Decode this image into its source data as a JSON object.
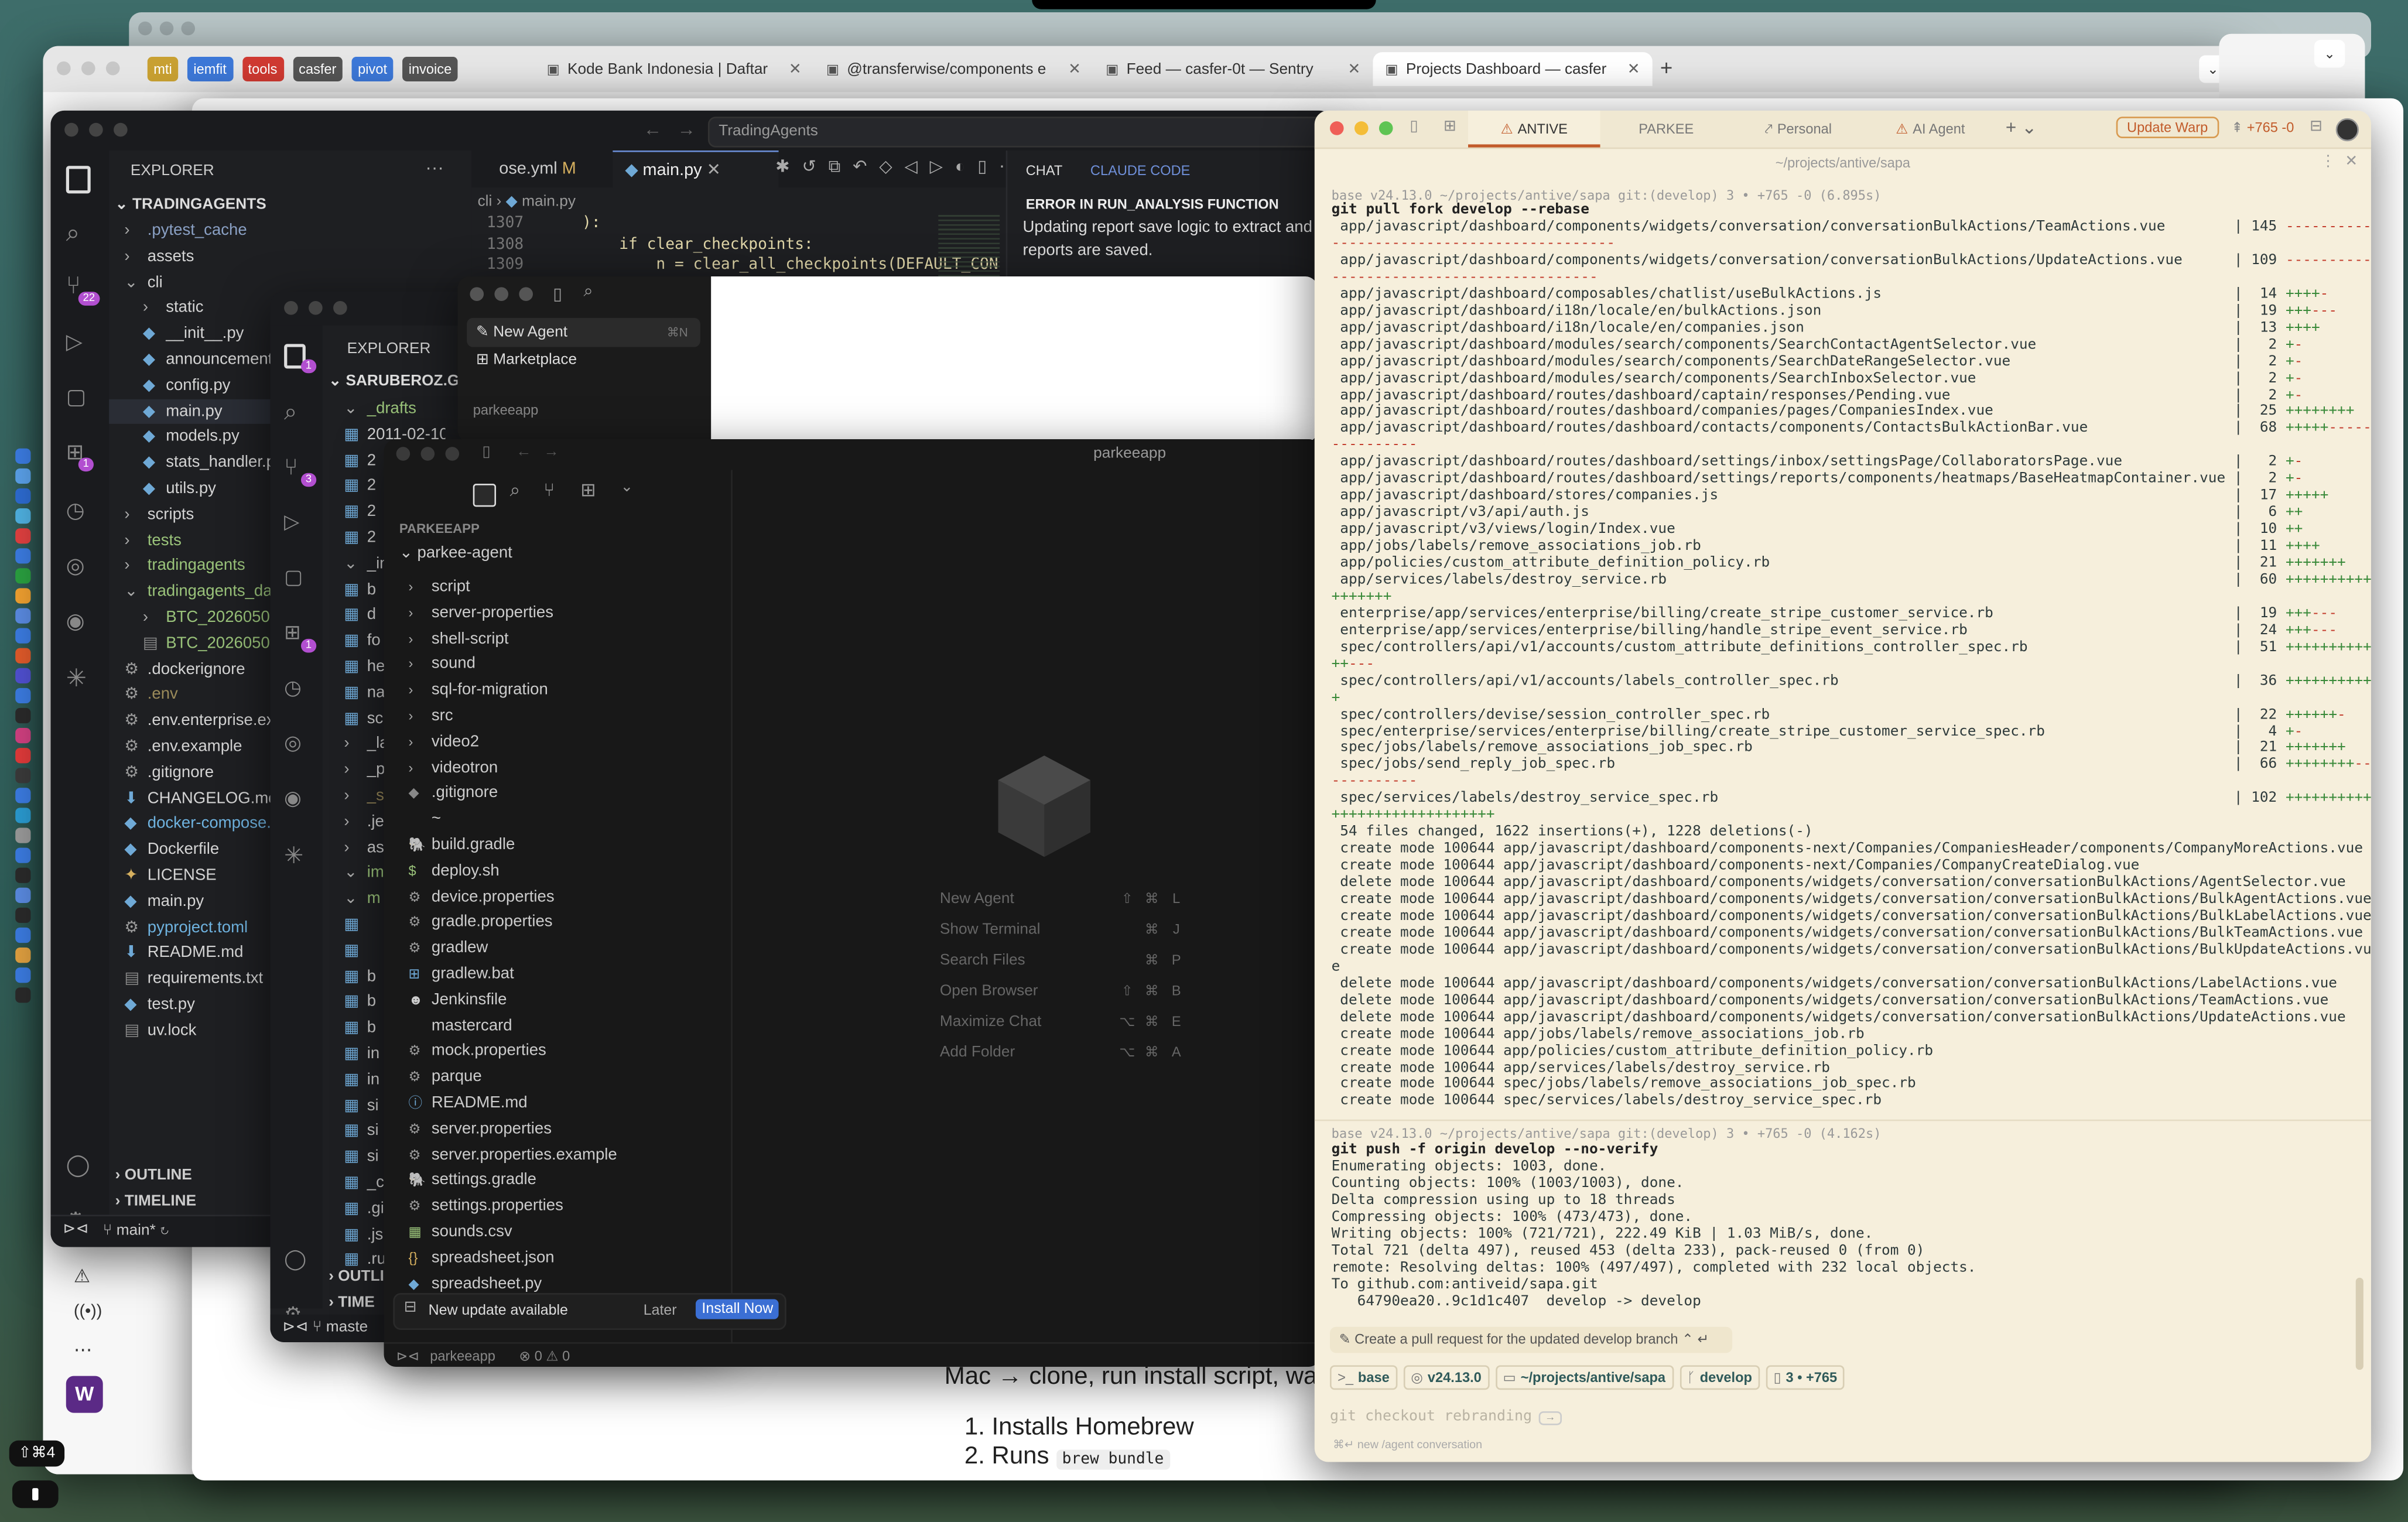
{
  "browser": {
    "tabs_pinned": [
      "mti",
      "iemfit",
      "tools",
      "casfer",
      "pivot",
      "invoice"
    ],
    "tabs": [
      {
        "label": "Kode Bank Indonesia | Daftar",
        "icon": "bank-tab-icon"
      },
      {
        "label": "@transferwise/components e",
        "icon": "npm-tab-icon"
      },
      {
        "label": "Feed — casfer-0t — Sentry",
        "icon": "sentry-tab-icon"
      },
      {
        "label": "Projects Dashboard — casfer",
        "icon": "sentry-tab-icon"
      }
    ],
    "new_tab": "+"
  },
  "vscode": {
    "title": "TradingAgents",
    "explorer": "EXPLORER",
    "project": "TRADINGAGENTS",
    "scm_badge": "22",
    "ext_badge": "1",
    "tree": [
      {
        "label": ".pytest_cache",
        "indent": 0,
        "type": "folder",
        "color": "#8aa0c4"
      },
      {
        "label": "assets",
        "indent": 0,
        "type": "folder",
        "color": "#d4d4d4"
      },
      {
        "label": "cli",
        "indent": 0,
        "type": "open",
        "color": "#d4d4d4"
      },
      {
        "label": "static",
        "indent": 1,
        "type": "folder",
        "color": "#d4d4d4"
      },
      {
        "label": "__init__.py",
        "indent": 1,
        "type": "py",
        "color": "#d4d4d4"
      },
      {
        "label": "announcements.",
        "indent": 1,
        "type": "py",
        "color": "#d4d4d4"
      },
      {
        "label": "config.py",
        "indent": 1,
        "type": "py",
        "color": "#d4d4d4"
      },
      {
        "label": "main.py",
        "indent": 1,
        "type": "py",
        "color": "#d4d4d4",
        "active": true
      },
      {
        "label": "models.py",
        "indent": 1,
        "type": "py",
        "color": "#d4d4d4"
      },
      {
        "label": "stats_handler.py",
        "indent": 1,
        "type": "py",
        "color": "#d4d4d4"
      },
      {
        "label": "utils.py",
        "indent": 1,
        "type": "py",
        "color": "#d4d4d4"
      },
      {
        "label": "scripts",
        "indent": 0,
        "type": "folder",
        "color": "#d4d4d4"
      },
      {
        "label": "tests",
        "indent": 0,
        "type": "folder",
        "color": "#9ac37a"
      },
      {
        "label": "tradingagents",
        "indent": 0,
        "type": "folder",
        "color": "#9ac37a"
      },
      {
        "label": "tradingagents_da",
        "indent": 0,
        "type": "open",
        "color": "#9ac37a"
      },
      {
        "label": "BTC_20260508_",
        "indent": 1,
        "type": "folder",
        "color": "#9ac37a"
      },
      {
        "label": "BTC_20260508_",
        "indent": 1,
        "type": "file",
        "color": "#9ac37a"
      },
      {
        "label": ".dockerignore",
        "indent": 0,
        "type": "gear",
        "color": "#d4d4d4"
      },
      {
        "label": ".env",
        "indent": 0,
        "type": "gear",
        "color": "#9a8a5a"
      },
      {
        "label": ".env.enterprise.ex",
        "indent": 0,
        "type": "gear",
        "color": "#d4d4d4"
      },
      {
        "label": ".env.example",
        "indent": 0,
        "type": "gear",
        "color": "#d4d4d4"
      },
      {
        "label": ".gitignore",
        "indent": 0,
        "type": "gear",
        "color": "#d4d4d4"
      },
      {
        "label": "CHANGELOG.md",
        "indent": 0,
        "type": "md",
        "color": "#d4d4d4"
      },
      {
        "label": "docker-compose.y",
        "indent": 0,
        "type": "py",
        "color": "#6fb3e0"
      },
      {
        "label": "Dockerfile",
        "indent": 0,
        "type": "py",
        "color": "#d4d4d4"
      },
      {
        "label": "LICENSE",
        "indent": 0,
        "type": "lic",
        "color": "#d4d4d4"
      },
      {
        "label": "main.py",
        "indent": 0,
        "type": "py",
        "color": "#d4d4d4"
      },
      {
        "label": "pyproject.toml",
        "indent": 0,
        "type": "gear",
        "color": "#6fb3e0"
      },
      {
        "label": "README.md",
        "indent": 0,
        "type": "md",
        "color": "#d4d4d4"
      },
      {
        "label": "requirements.txt",
        "indent": 0,
        "type": "file",
        "color": "#d4d4d4"
      },
      {
        "label": "test.py",
        "indent": 0,
        "type": "py",
        "color": "#d4d4d4"
      },
      {
        "label": "uv.lock",
        "indent": 0,
        "type": "file",
        "color": "#d4d4d4"
      }
    ],
    "outline": "OUTLINE",
    "timeline": "TIMELINE",
    "branch": "main*",
    "tab1": "ose.yml",
    "tab1_mark": "M",
    "tab2": "main.py",
    "breadcrumb_a": "cli",
    "breadcrumb_b": "main.py",
    "code": [
      {
        "ln": "1307",
        "text": "    ):"
      },
      {
        "ln": "1308",
        "text": "        if clear_checkpoints:"
      },
      {
        "ln": "1309",
        "text": "            n = clear_all_checkpoints(DEFAULT_CON"
      }
    ],
    "chat_tab": "CHAT",
    "claude_tab": "CLAUDE CODE",
    "chat_heading": "ERROR IN RUN_ANALYSIS FUNCTION",
    "chat_text_1": "Updating report save logic to extract and",
    "chat_text_2": "reports are saved."
  },
  "editor2": {
    "explorer": "EXPLORER",
    "project": "SARUBEROZ.GIT",
    "badge_a": "1",
    "badge_b": "3",
    "badge_c": "1",
    "tree": [
      {
        "label": "_drafts",
        "color": "#9ac37a",
        "type": "open"
      },
      {
        "label": "2011-02-10",
        "color": "#d4d4d4",
        "type": "file"
      },
      {
        "label": "2",
        "color": "#d4d4d4",
        "type": "file"
      },
      {
        "label": "2",
        "color": "#d4d4d4",
        "type": "file"
      },
      {
        "label": "2",
        "color": "#d4d4d4",
        "type": "file"
      },
      {
        "label": "2",
        "color": "#d4d4d4",
        "type": "file"
      },
      {
        "label": "_in",
        "color": "#d4d4d4",
        "type": "open"
      },
      {
        "label": "b",
        "color": "#d4d4d4",
        "type": "file"
      },
      {
        "label": "d",
        "color": "#d4d4d4",
        "type": "file"
      },
      {
        "label": "fo",
        "color": "#d4d4d4",
        "type": "file"
      },
      {
        "label": "he",
        "color": "#d4d4d4",
        "type": "file"
      },
      {
        "label": "na",
        "color": "#d4d4d4",
        "type": "file"
      },
      {
        "label": "sc",
        "color": "#d4d4d4",
        "type": "file"
      },
      {
        "label": "_la",
        "color": "#d4d4d4",
        "type": "folder"
      },
      {
        "label": "_p",
        "color": "#d4d4d4",
        "type": "folder"
      },
      {
        "label": "_si",
        "color": "#9a8a5a",
        "type": "folder"
      },
      {
        "label": ".jel",
        "color": "#d4d4d4",
        "type": "folder"
      },
      {
        "label": "ass",
        "color": "#d4d4d4",
        "type": "folder"
      },
      {
        "label": "ima",
        "color": "#9ac37a",
        "type": "open"
      },
      {
        "label": "m",
        "color": "#9ac37a",
        "type": "open"
      },
      {
        "label": "",
        "color": "#d4d4d4",
        "type": "file"
      },
      {
        "label": "",
        "color": "#d4d4d4",
        "type": "file"
      },
      {
        "label": "b",
        "color": "#d4d4d4",
        "type": "file"
      },
      {
        "label": "b",
        "color": "#d4d4d4",
        "type": "file"
      },
      {
        "label": "b",
        "color": "#d4d4d4",
        "type": "file"
      },
      {
        "label": "in",
        "color": "#d4d4d4",
        "type": "file"
      },
      {
        "label": "in",
        "color": "#d4d4d4",
        "type": "file"
      },
      {
        "label": "si",
        "color": "#d4d4d4",
        "type": "file"
      },
      {
        "label": "si",
        "color": "#d4d4d4",
        "type": "file"
      },
      {
        "label": "si",
        "color": "#d4d4d4",
        "type": "file"
      },
      {
        "label": "_co",
        "color": "#d4d4d4",
        "type": "file"
      },
      {
        "label": ".git",
        "color": "#d4d4d4",
        "type": "file"
      },
      {
        "label": ".jsh",
        "color": "#d4d4d4",
        "type": "file"
      },
      {
        "label": ".ru",
        "color": "#d4d4d4",
        "type": "file"
      }
    ],
    "outline": "OUTLI",
    "timeline": "TIME",
    "branch": "maste"
  },
  "cursor": {
    "menu_new_agent": "New Agent",
    "menu_new_agent_kbd": "⌘N",
    "menu_marketplace": "Marketplace",
    "section": "parkeeapp",
    "title": "parkeeapp",
    "project": "PARKEEAPP",
    "folder": "parkee-agent",
    "tree": [
      {
        "label": "script",
        "type": "folder"
      },
      {
        "label": "server-properties",
        "type": "folder"
      },
      {
        "label": "shell-script",
        "type": "folder"
      },
      {
        "label": "sound",
        "type": "folder"
      },
      {
        "label": "sql-for-migration",
        "type": "folder"
      },
      {
        "label": "src",
        "type": "folder"
      },
      {
        "label": "video2",
        "type": "folder"
      },
      {
        "label": "videotron",
        "type": "folder"
      },
      {
        "label": ".gitignore",
        "type": "git"
      },
      {
        "label": "~",
        "type": "blank"
      },
      {
        "label": "build.gradle",
        "type": "gradle"
      },
      {
        "label": "deploy.sh",
        "type": "dollar"
      },
      {
        "label": "device.properties",
        "type": "gear"
      },
      {
        "label": "gradle.properties",
        "type": "gear"
      },
      {
        "label": "gradlew",
        "type": "gear"
      },
      {
        "label": "gradlew.bat",
        "type": "win"
      },
      {
        "label": "Jenkinsfile",
        "type": "jenkins"
      },
      {
        "label": "mastercard",
        "type": "blank"
      },
      {
        "label": "mock.properties",
        "type": "gear"
      },
      {
        "label": "parque",
        "type": "gear"
      },
      {
        "label": "README.md",
        "type": "info"
      },
      {
        "label": "server.properties",
        "type": "gear"
      },
      {
        "label": "server.properties.example",
        "type": "gear"
      },
      {
        "label": "settings.gradle",
        "type": "gradle"
      },
      {
        "label": "settings.properties",
        "type": "gear"
      },
      {
        "label": "sounds.csv",
        "type": "csv"
      },
      {
        "label": "spreadsheet.json",
        "type": "json"
      },
      {
        "label": "spreadsheet.py",
        "type": "py"
      }
    ],
    "shortcuts": [
      {
        "label": "New Agent",
        "k1": "⇧",
        "k2": "⌘",
        "k3": "L"
      },
      {
        "label": "Show Terminal",
        "k1": "",
        "k2": "⌘",
        "k3": "J"
      },
      {
        "label": "Search Files",
        "k1": "",
        "k2": "⌘",
        "k3": "P"
      },
      {
        "label": "Open Browser",
        "k1": "⇧",
        "k2": "⌘",
        "k3": "B"
      },
      {
        "label": "Maximize Chat",
        "k1": "⌥",
        "k2": "⌘",
        "k3": "E"
      },
      {
        "label": "Add Folder",
        "k1": "⌥",
        "k2": "⌘",
        "k3": "A"
      }
    ],
    "update_text": "New update available",
    "later": "Later",
    "install": "Install Now",
    "status_project": "parkeeapp",
    "status_errors": "⊗ 0 ⚠ 0"
  },
  "doc": {
    "heading": "Mac → clone, run install script, walk",
    "item1": "1. Installs Homebrew",
    "item2_prefix": "2. Runs",
    "item2_code": "brew bundle"
  },
  "warp": {
    "tabs": [
      {
        "label": "ANTIVE",
        "icon": "warning-icon",
        "active": true
      },
      {
        "label": "PARKEE",
        "icon": "",
        "active": false
      },
      {
        "label": "Personal",
        "icon": "link-icon",
        "active": false
      },
      {
        "label": "AI Agent",
        "icon": "warning-icon",
        "active": false
      }
    ],
    "update": "Update Warp",
    "diff_stat": "+765 -0",
    "path": "~/projects/antive/sapa",
    "prompt1": "base v24.13.0 ~/projects/antive/sapa git:(develop) 3 • +765 -0 (6.895s)",
    "cmd1": "git pull fork develop --rebase",
    "output1": [
      " app/javascript/dashboard/components/widgets/conversation/conversationBulkActions/TeamActions.vue        | 145 ----------",
      "---------------------------------",
      " app/javascript/dashboard/components/widgets/conversation/conversationBulkActions/UpdateActions.vue      | 109 ----------",
      "-------------------------------",
      " app/javascript/dashboard/composables/chatlist/useBulkActions.js                                         |  14 ++++-",
      " app/javascript/dashboard/i18n/locale/en/bulkActions.json                                                |  19 +++---",
      " app/javascript/dashboard/i18n/locale/en/companies.json                                                  |  13 ++++",
      " app/javascript/dashboard/modules/search/components/SearchContactAgentSelector.vue                       |   2 +-",
      " app/javascript/dashboard/modules/search/components/SearchDateRangeSelector.vue                          |   2 +-",
      " app/javascript/dashboard/modules/search/components/SearchInboxSelector.vue                              |   2 +-",
      " app/javascript/dashboard/routes/dashboard/captain/responses/Pending.vue                                 |   2 +-",
      " app/javascript/dashboard/routes/dashboard/companies/pages/CompaniesIndex.vue                            |  25 ++++++++",
      " app/javascript/dashboard/routes/dashboard/contacts/components/ContactsBulkActionBar.vue                 |  68 +++++-----",
      "----------",
      " app/javascript/dashboard/routes/dashboard/settings/inbox/settingsPage/CollaboratorsPage.vue             |   2 +-",
      " app/javascript/dashboard/routes/dashboard/settings/reports/components/heatmaps/BaseHeatmapContainer.vue |   2 +-",
      " app/javascript/dashboard/stores/companies.js                                                            |  17 +++++",
      " app/javascript/v3/api/auth.js                                                                           |   6 ++",
      " app/javascript/v3/views/login/Index.vue                                                                 |  10 ++",
      " app/jobs/labels/remove_associations_job.rb                                                              |  11 ++++",
      " app/policies/custom_attribute_definition_policy.rb                                                      |  21 +++++++",
      " app/services/labels/destroy_service.rb                                                                  |  60 ++++++++++",
      "+++++++",
      " enterprise/app/services/enterprise/billing/create_stripe_customer_service.rb                            |  19 +++---",
      " enterprise/app/services/enterprise/billing/handle_stripe_event_service.rb                               |  24 +++---",
      " spec/controllers/api/v1/accounts/custom_attribute_definitions_controller_spec.rb                        |  51 ++++++++++",
      "++---",
      " spec/controllers/api/v1/accounts/labels_controller_spec.rb                                              |  36 ++++++++++",
      "+",
      " spec/controllers/devise/session_controller_spec.rb                                                      |  22 ++++++-",
      " spec/enterprise/services/enterprise/billing/create_stripe_customer_service_spec.rb                      |   4 +-",
      " spec/jobs/labels/remove_associations_job_spec.rb                                                        |  21 +++++++",
      " spec/jobs/send_reply_job_spec.rb                                                                        |  66 ++++++++---",
      "----------",
      " spec/services/labels/destroy_service_spec.rb                                                            | 102 ++++++++++",
      "+++++++++++++++++++",
      " 54 files changed, 1622 insertions(+), 1228 deletions(-)",
      " create mode 100644 app/javascript/dashboard/components-next/Companies/CompaniesHeader/components/CompanyMoreActions.vue",
      " create mode 100644 app/javascript/dashboard/components-next/Companies/CompanyCreateDialog.vue",
      " delete mode 100644 app/javascript/dashboard/components/widgets/conversation/conversationBulkActions/AgentSelector.vue",
      " create mode 100644 app/javascript/dashboard/components/widgets/conversation/conversationBulkActions/BulkAgentActions.vue",
      " create mode 100644 app/javascript/dashboard/components/widgets/conversation/conversationBulkActions/BulkLabelActions.vue",
      " create mode 100644 app/javascript/dashboard/components/widgets/conversation/conversationBulkActions/BulkTeamActions.vue",
      " create mode 100644 app/javascript/dashboard/components/widgets/conversation/conversationBulkActions/BulkUpdateActions.vu",
      "e",
      " delete mode 100644 app/javascript/dashboard/components/widgets/conversation/conversationBulkActions/LabelActions.vue",
      " delete mode 100644 app/javascript/dashboard/components/widgets/conversation/conversationBulkActions/TeamActions.vue",
      " delete mode 100644 app/javascript/dashboard/components/widgets/conversation/conversationBulkActions/UpdateActions.vue",
      " create mode 100644 app/jobs/labels/remove_associations_job.rb",
      " create mode 100644 app/policies/custom_attribute_definition_policy.rb",
      " create mode 100644 app/services/labels/destroy_service.rb",
      " create mode 100644 spec/jobs/labels/remove_associations_job_spec.rb",
      " create mode 100644 spec/services/labels/destroy_service_spec.rb"
    ],
    "prompt2": "base v24.13.0 ~/projects/antive/sapa git:(develop) 3 • +765 -0 (4.162s)",
    "cmd2": "git push -f origin develop --no-verify",
    "output2": [
      "Enumerating objects: 1003, done.",
      "Counting objects: 100% (1003/1003), done.",
      "Delta compression using up to 18 threads",
      "Compressing objects: 100% (473/473), done.",
      "Writing objects: 100% (721/721), 222.49 KiB | 1.03 MiB/s, done.",
      "Total 721 (delta 497), reused 453 (delta 233), pack-reused 0 (from 0)",
      "remote: Resolving deltas: 100% (497/497), completed with 232 local objects.",
      "To github.com:antiveid/sapa.git",
      "   64790ea20..9c1d1c407  develop -> develop"
    ],
    "suggestion": "Create a pull request for the updated develop branch",
    "chips": [
      {
        "label": "base",
        "icon": ">_"
      },
      {
        "label": "v24.13.0",
        "icon": "◎"
      },
      {
        "label": "~/projects/antive/sapa",
        "icon": "▭"
      },
      {
        "label": "develop",
        "icon": "ᚴ"
      },
      {
        "label": "3 • +765",
        "icon": "▯"
      }
    ],
    "input_placeholder": "git checkout rebranding",
    "input_hint": "→",
    "footer": "⌘↵ new /agent conversation"
  },
  "dock": {
    "shortcut": "⇧⌘4",
    "w_app": "W"
  },
  "colors": {
    "warp_bg": "#f6efdc",
    "warp_text": "#2f3b3c",
    "warp_accent": "#c25b2a",
    "vscode_bg": "#1e1f22",
    "install_btn": "#3b6fd4"
  }
}
